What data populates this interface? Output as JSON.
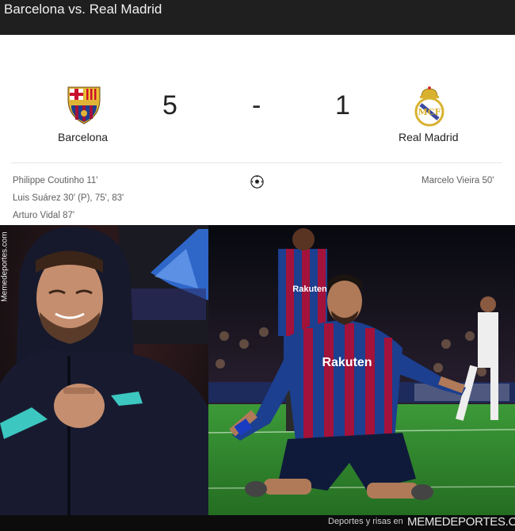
{
  "header": {
    "title": "Barcelona vs. Real Madrid"
  },
  "match": {
    "home": {
      "name": "Barcelona",
      "score": "5",
      "crest_icon": "barcelona-crest-icon"
    },
    "away": {
      "name": "Real Madrid",
      "score": "1",
      "crest_icon": "real-madrid-crest-icon"
    },
    "separator": "-",
    "goal_icon": "soccer-ball-icon",
    "home_scorers": [
      "Philippe Coutinho 11'",
      "Luis Suárez 30' (P), 75', 83'",
      "Arturo Vidal 87'"
    ],
    "away_scorers": [
      "Marcelo Vieira 50'"
    ]
  },
  "photos": {
    "left": {
      "jersey_text": ""
    },
    "right": {
      "sponsor": "Rakuten",
      "back_sponsor": "Rakuten"
    }
  },
  "watermark": {
    "side": "Memedeportes.com",
    "footer_tagline": "Deportes y risas en",
    "footer_brand": "MEMEDEPORTES.COM"
  },
  "colors": {
    "header_bg": "#1f1f1f",
    "card_bg": "#ffffff",
    "barca_blue": "#1c3f8f",
    "barca_red": "#a3123a",
    "pitch_green": "#2f8a2e"
  }
}
